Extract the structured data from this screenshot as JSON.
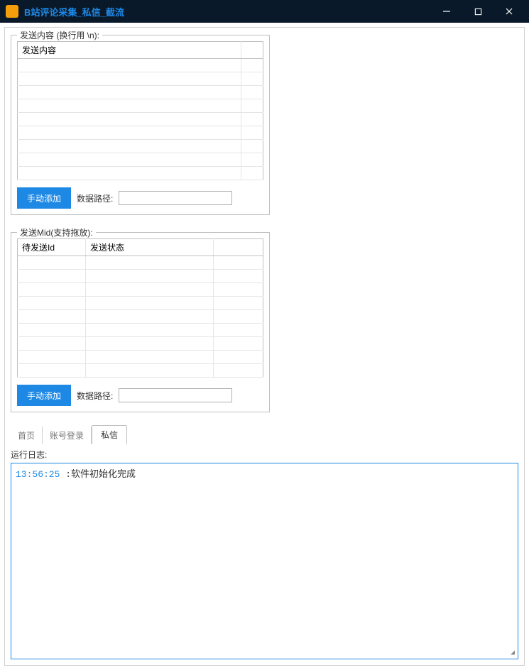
{
  "window": {
    "title": "B站评论采集_私信_截流"
  },
  "section_content": {
    "legend": "发送内容 (换行用 \\n):",
    "header_col1": "发送内容",
    "add_button": "手动添加",
    "path_label": "数据路径:",
    "path_value": ""
  },
  "section_mid": {
    "legend": "发送Mid(支持拖放):",
    "header_col1": "待发送Id",
    "header_col2": "发送状态",
    "add_button": "手动添加",
    "path_label": "数据路径:",
    "path_value": ""
  },
  "tabs": {
    "home": "首页",
    "login": "账号登录",
    "dm": "私信"
  },
  "log": {
    "label": "运行日志:",
    "entries": [
      {
        "time": "13:56:25",
        "sep": " :",
        "msg": "软件初始化完成"
      }
    ]
  }
}
